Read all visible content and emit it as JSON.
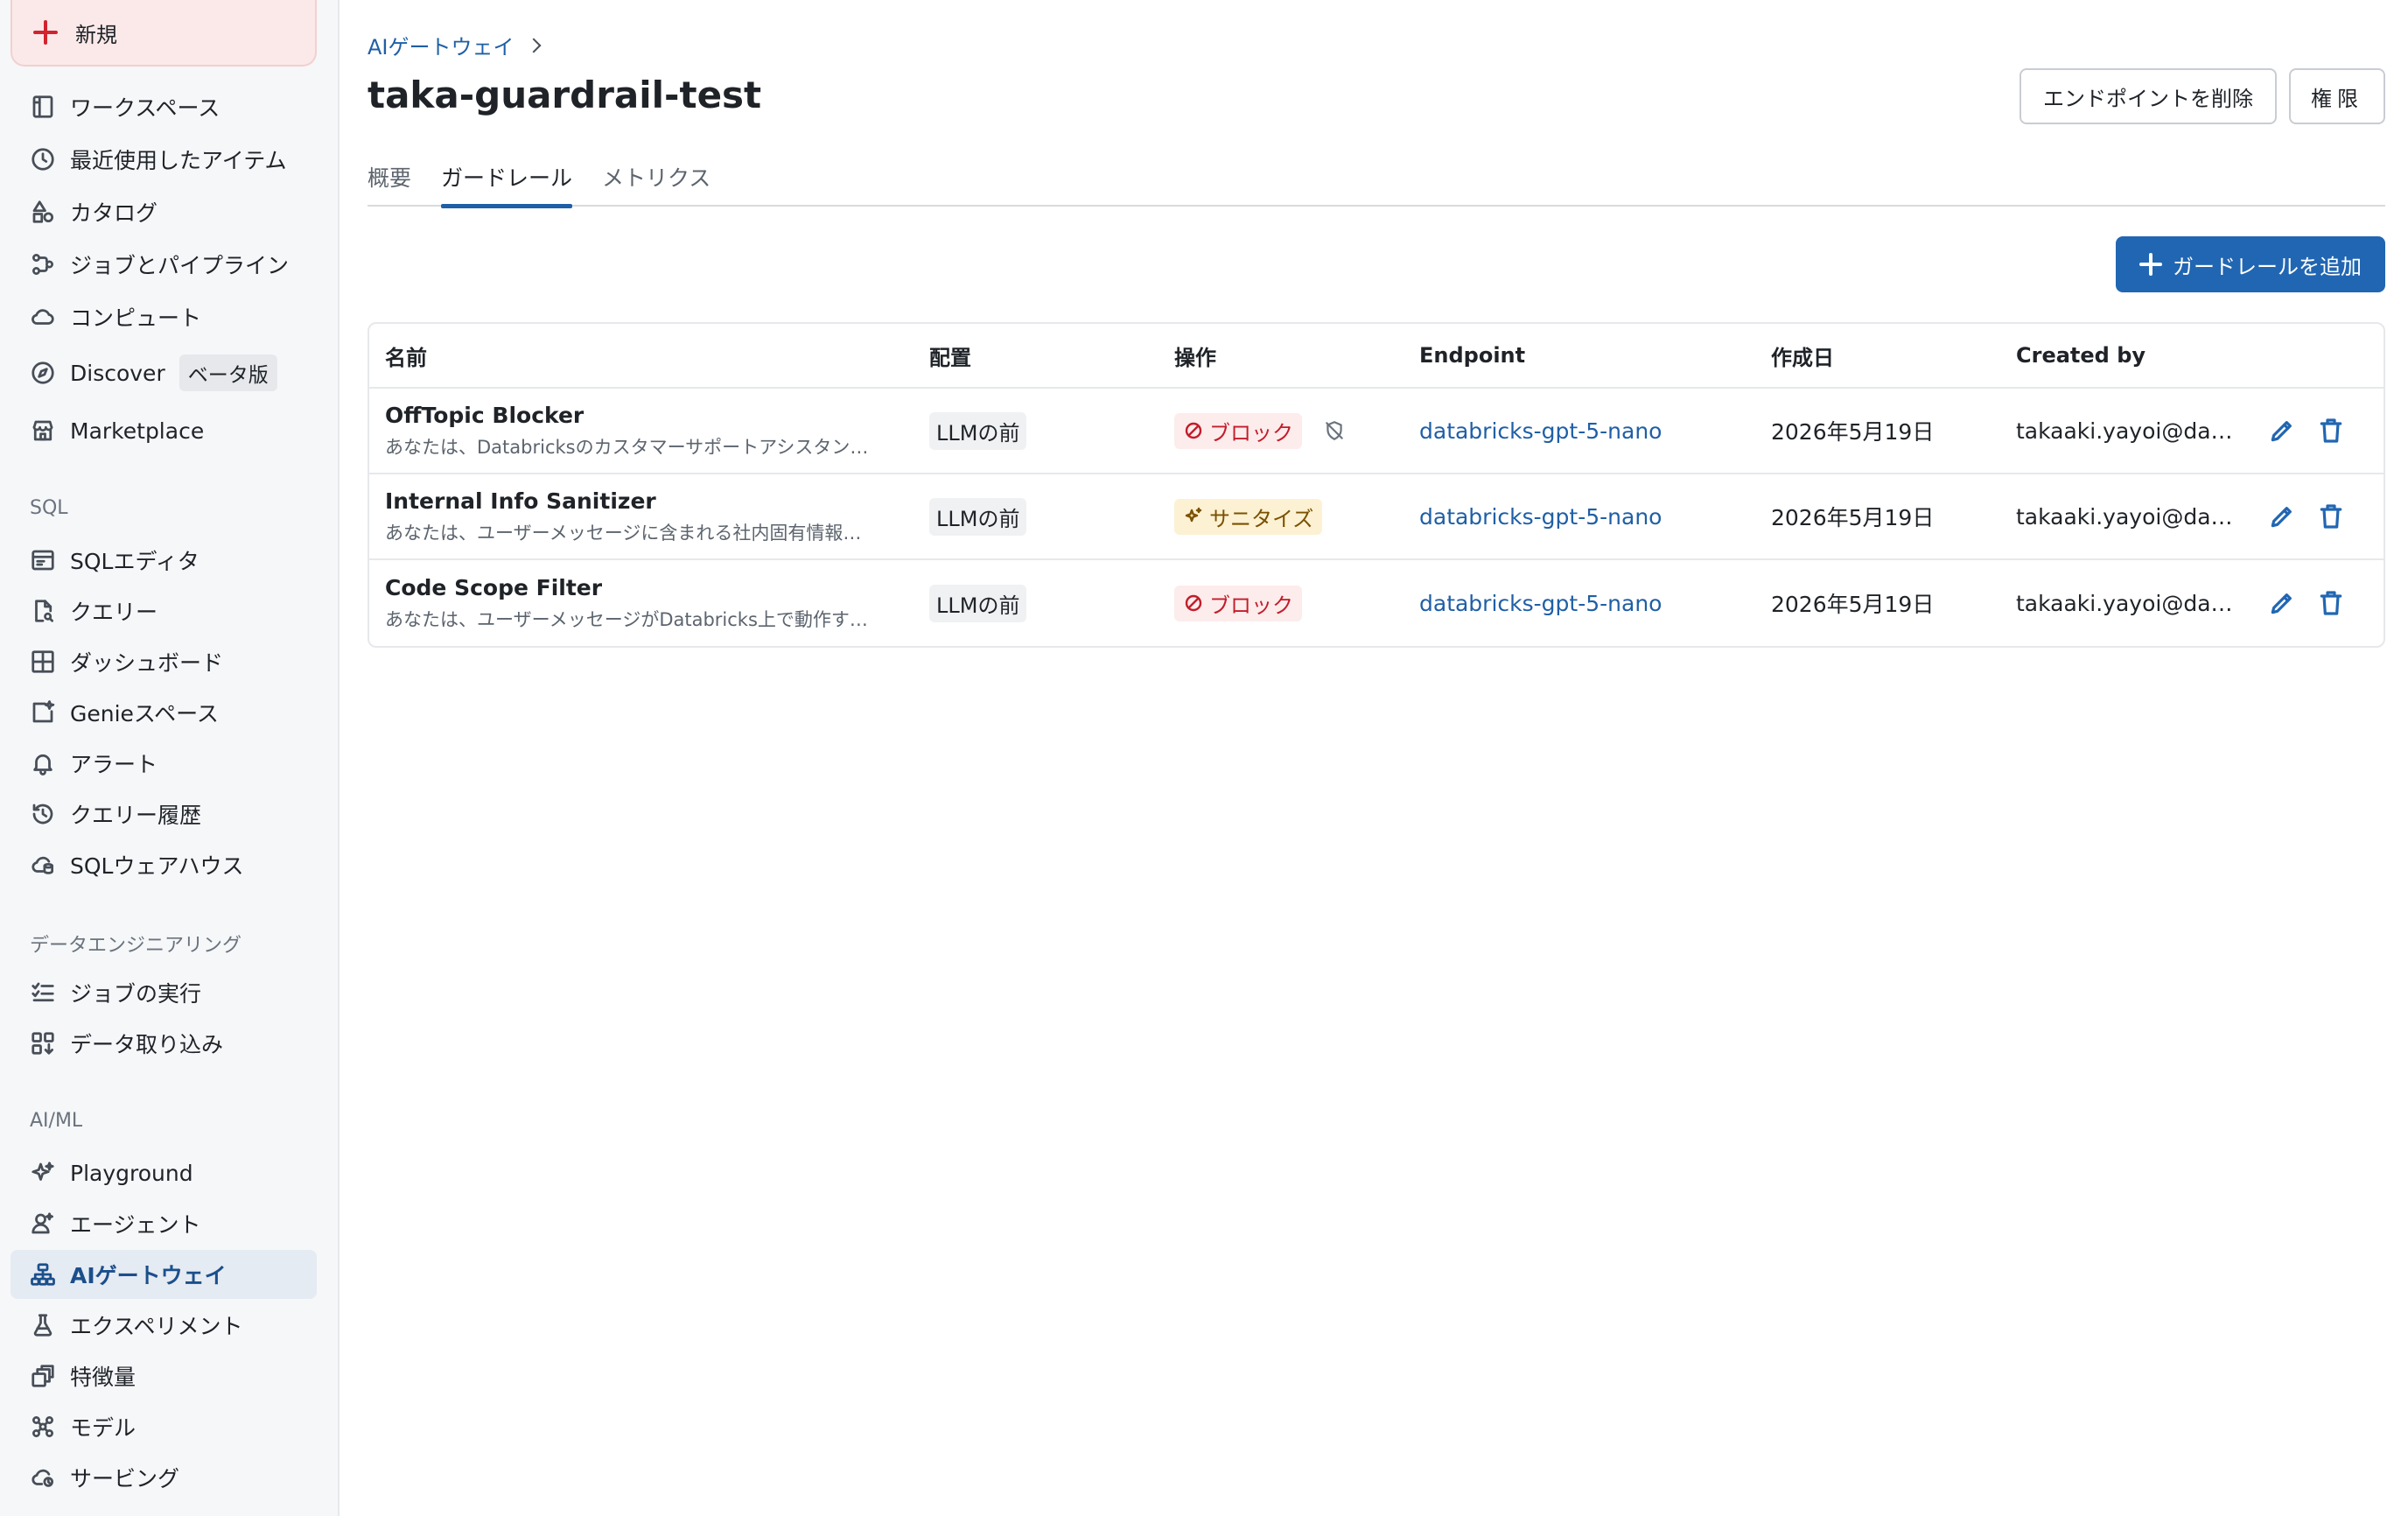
{
  "sidebar": {
    "new_label": "新規",
    "items_top": [
      {
        "label": "ワークスペース",
        "icon": "workspace-icon"
      },
      {
        "label": "最近使用したアイテム",
        "icon": "clock-icon"
      },
      {
        "label": "カタログ",
        "icon": "catalog-icon"
      },
      {
        "label": "ジョブとパイプライン",
        "icon": "workflow-icon"
      },
      {
        "label": "コンピュート",
        "icon": "cloud-icon"
      },
      {
        "label": "Discover",
        "icon": "compass-icon",
        "badge": "ベータ版"
      },
      {
        "label": "Marketplace",
        "icon": "store-icon"
      }
    ],
    "sql_section": "SQL",
    "items_sql": [
      {
        "label": "SQLエディタ",
        "icon": "sql-editor-icon"
      },
      {
        "label": "クエリー",
        "icon": "query-icon"
      },
      {
        "label": "ダッシュボード",
        "icon": "dashboard-icon"
      },
      {
        "label": "Genieスペース",
        "icon": "genie-icon"
      },
      {
        "label": "アラート",
        "icon": "bell-icon"
      },
      {
        "label": "クエリー履歴",
        "icon": "history-icon"
      },
      {
        "label": "SQLウェアハウス",
        "icon": "warehouse-icon"
      }
    ],
    "de_section": "データエンジニアリング",
    "items_de": [
      {
        "label": "ジョブの実行",
        "icon": "job-runs-icon"
      },
      {
        "label": "データ取り込み",
        "icon": "ingestion-icon"
      }
    ],
    "ml_section": "AI/ML",
    "items_ml": [
      {
        "label": "Playground",
        "icon": "sparkle-icon"
      },
      {
        "label": "エージェント",
        "icon": "agent-icon"
      },
      {
        "label": "AIゲートウェイ",
        "icon": "gateway-icon",
        "active": true
      },
      {
        "label": "エクスペリメント",
        "icon": "beaker-icon"
      },
      {
        "label": "特徴量",
        "icon": "feature-icon"
      },
      {
        "label": "モデル",
        "icon": "model-icon"
      },
      {
        "label": "サービング",
        "icon": "serving-icon"
      }
    ]
  },
  "header": {
    "breadcrumb": "AIゲートウェイ",
    "title": "taka-guardrail-test",
    "delete_label": "エンドポイントを削除",
    "permissions_label": "権限"
  },
  "tabs": [
    {
      "label": "概要",
      "active": false
    },
    {
      "label": "ガードレール",
      "active": true
    },
    {
      "label": "メトリクス",
      "active": false
    }
  ],
  "add_guardrail_label": "ガードレールを追加",
  "table": {
    "columns": [
      "名前",
      "配置",
      "操作",
      "Endpoint",
      "作成日",
      "Created by"
    ],
    "rows": [
      {
        "name": "OffTopic Blocker",
        "description": "あなたは、Databricksのカスタマーサポートアシスタン…",
        "placement": "LLMの前",
        "action": "ブロック",
        "action_type": "block",
        "shield": true,
        "endpoint": "databricks-gpt-5-nano",
        "created": "2026年5月19日",
        "created_by": "takaaki.yayoi@dat..."
      },
      {
        "name": "Internal Info Sanitizer",
        "description": "あなたは、ユーザーメッセージに含まれる社内固有情報…",
        "placement": "LLMの前",
        "action": "サニタイズ",
        "action_type": "sanitize",
        "shield": false,
        "endpoint": "databricks-gpt-5-nano",
        "created": "2026年5月19日",
        "created_by": "takaaki.yayoi@dat..."
      },
      {
        "name": "Code Scope Filter",
        "description": "あなたは、ユーザーメッセージがDatabricks上で動作す…",
        "placement": "LLMの前",
        "action": "ブロック",
        "action_type": "block",
        "shield": false,
        "endpoint": "databricks-gpt-5-nano",
        "created": "2026年5月19日",
        "created_by": "takaaki.yayoi@dat..."
      }
    ]
  },
  "colors": {
    "primary": "#2166b2",
    "link": "#1f5fa6",
    "block": "#c21d2b",
    "sanitize": "#7a5200"
  }
}
